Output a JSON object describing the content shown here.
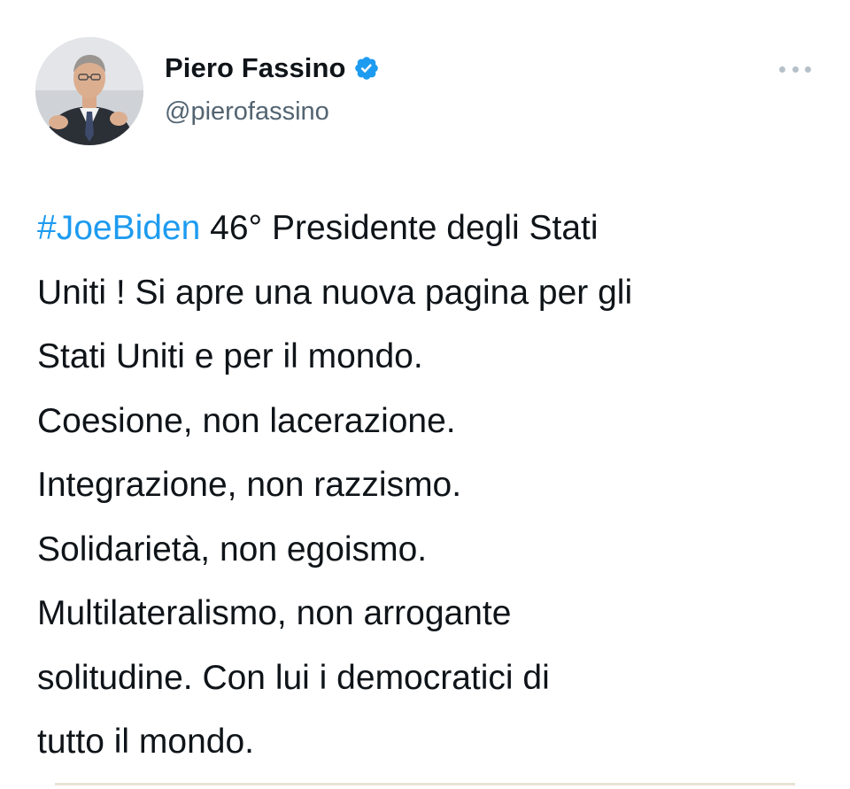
{
  "author": {
    "display_name": "Piero Fassino",
    "handle": "@pierofassino",
    "verified_badge_icon": "verified-badge-icon",
    "avatar_icon": "avatar-photo"
  },
  "menu": {
    "more_icon": "more-options-icon"
  },
  "tweet": {
    "hashtag": "#JoeBiden",
    "line1_rest": " 46° Presidente degli Stati",
    "line2": "Uniti ! Si apre una nuova pagina per gli",
    "line3": "Stati Uniti e per il mondo.",
    "line4": "Coesione, non lacerazione.",
    "line5": "Integrazione, non razzismo.",
    "line6": "Solidarietà, non egoismo.",
    "line7": "Multilateralismo, non arrogante",
    "line8": "solitudine. Con lui i democratici di",
    "line9": "tutto il mondo."
  },
  "colors": {
    "hashtag": "#1d9bf0",
    "verified": "#1d9bf0",
    "secondary_text": "#536471"
  }
}
